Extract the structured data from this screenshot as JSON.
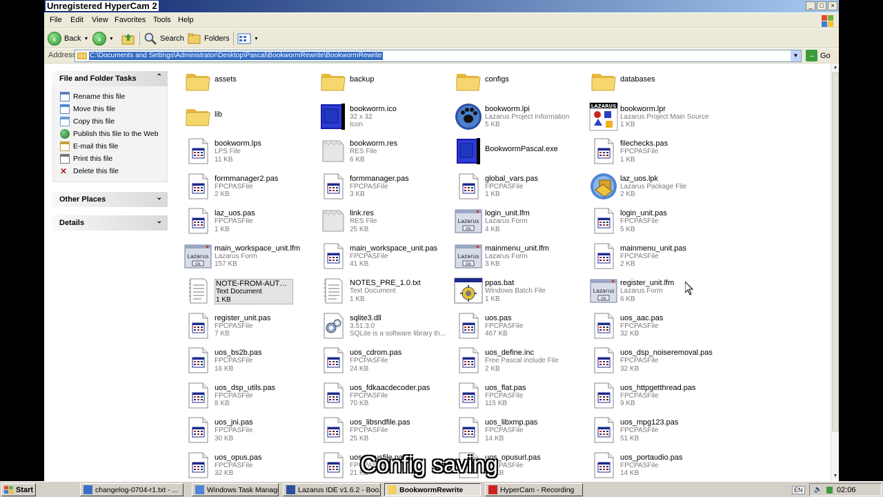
{
  "window": {
    "title": "Unregistered HyperCam 2",
    "controls": [
      "_",
      "□",
      "×"
    ]
  },
  "menu": [
    "File",
    "Edit",
    "View",
    "Favorites",
    "Tools",
    "Help"
  ],
  "toolbar": {
    "back": "Back",
    "search": "Search",
    "folders": "Folders"
  },
  "address": {
    "label": "Address",
    "value": "C:\\Documents and Settings\\Administrator\\Desktop\\Pascal\\BookwormRewrite\\BookwormRewrite",
    "go": "Go"
  },
  "tasks_panel": {
    "title": "File and Folder Tasks",
    "items": [
      {
        "label": "Rename this file",
        "icon": "rename-icon"
      },
      {
        "label": "Move this file",
        "icon": "move-icon"
      },
      {
        "label": "Copy this file",
        "icon": "copy-icon"
      },
      {
        "label": "Publish this file to the Web",
        "icon": "globe-icon"
      },
      {
        "label": "E-mail this file",
        "icon": "email-icon"
      },
      {
        "label": "Print this file",
        "icon": "printer-icon"
      },
      {
        "label": "Delete this file",
        "icon": "delete-icon"
      }
    ]
  },
  "other_places": {
    "title": "Other Places"
  },
  "details": {
    "title": "Details"
  },
  "files": [
    {
      "name": "assets",
      "icon": "folder"
    },
    {
      "name": "backup",
      "icon": "folder"
    },
    {
      "name": "configs",
      "icon": "folder"
    },
    {
      "name": "databases",
      "icon": "folder"
    },
    {
      "name": "lib",
      "icon": "folder"
    },
    {
      "name": "bookworm.ico",
      "type": "32 x 32",
      "size": "Icon",
      "icon": "ico"
    },
    {
      "name": "bookworm.lpi",
      "type": "Lazarus Project Information",
      "size": "5 KB",
      "icon": "lpi"
    },
    {
      "name": "bookworm.lpr",
      "type": "Lazarus Project Main Source",
      "size": "1 KB",
      "icon": "lpr"
    },
    {
      "name": "bookworm.lps",
      "type": "LPS File",
      "size": "11 KB",
      "icon": "pas"
    },
    {
      "name": "bookworm.res",
      "type": "RES File",
      "size": "6 KB",
      "icon": "res"
    },
    {
      "name": "BookwormPascal.exe",
      "icon": "exe"
    },
    {
      "name": "filechecks.pas",
      "type": "FPCPASFile",
      "size": "1 KB",
      "icon": "pas"
    },
    {
      "name": "formmanager2.pas",
      "type": "FPCPASFile",
      "size": "2 KB",
      "icon": "pas"
    },
    {
      "name": "formmanager.pas",
      "type": "FPCPASFile",
      "size": "3 KB",
      "icon": "pas"
    },
    {
      "name": "global_vars.pas",
      "type": "FPCPASFile",
      "size": "1 KB",
      "icon": "pas"
    },
    {
      "name": "laz_uos.lpk",
      "type": "Lazarus Package File",
      "size": "2 KB",
      "icon": "lpk"
    },
    {
      "name": "laz_uos.pas",
      "type": "FPCPASFile",
      "size": "1 KB",
      "icon": "pas"
    },
    {
      "name": "link.res",
      "type": "RES File",
      "size": "25 KB",
      "icon": "res"
    },
    {
      "name": "login_unit.lfm",
      "type": "Lazarus Form",
      "size": "4 KB",
      "icon": "lfm"
    },
    {
      "name": "login_unit.pas",
      "type": "FPCPASFile",
      "size": "5 KB",
      "icon": "pas"
    },
    {
      "name": "main_workspace_unit.lfm",
      "type": "Lazarus Form",
      "size": "157 KB",
      "icon": "lfm"
    },
    {
      "name": "main_workspace_unit.pas",
      "type": "FPCPASFile",
      "size": "41 KB",
      "icon": "pas"
    },
    {
      "name": "mainmenu_unit.lfm",
      "type": "Lazarus Form",
      "size": "3 KB",
      "icon": "lfm"
    },
    {
      "name": "mainmenu_unit.pas",
      "type": "FPCPASFile",
      "size": "2 KB",
      "icon": "pas"
    },
    {
      "name": "NOTE-FROM-AUTHOR.txt",
      "type": "Text Document",
      "size": "1 KB",
      "icon": "txt",
      "selected": true
    },
    {
      "name": "NOTES_PRE_1.0.txt",
      "type": "Text Document",
      "size": "1 KB",
      "icon": "txt"
    },
    {
      "name": "ppas.bat",
      "type": "Windows Batch File",
      "size": "1 KB",
      "icon": "bat"
    },
    {
      "name": "register_unit.lfm",
      "type": "Lazarus Form",
      "size": "6 KB",
      "icon": "lfm"
    },
    {
      "name": "register_unit.pas",
      "type": "FPCPASFile",
      "size": "7 KB",
      "icon": "pas"
    },
    {
      "name": "sqlite3.dll",
      "type": "3.51.3.0",
      "size": "SQLite is a software library th...",
      "icon": "dll"
    },
    {
      "name": "uos.pas",
      "type": "FPCPASFile",
      "size": "467 KB",
      "icon": "pas"
    },
    {
      "name": "uos_aac.pas",
      "type": "FPCPASFile",
      "size": "32 KB",
      "icon": "pas"
    },
    {
      "name": "uos_bs2b.pas",
      "type": "FPCPASFile",
      "size": "16 KB",
      "icon": "pas"
    },
    {
      "name": "uos_cdrom.pas",
      "type": "FPCPASFile",
      "size": "24 KB",
      "icon": "pas"
    },
    {
      "name": "uos_define.inc",
      "type": "Free Pascal include File",
      "size": "2 KB",
      "icon": "pas"
    },
    {
      "name": "uos_dsp_noiseremoval.pas",
      "type": "FPCPASFile",
      "size": "32 KB",
      "icon": "pas"
    },
    {
      "name": "uos_dsp_utils.pas",
      "type": "FPCPASFile",
      "size": "8 KB",
      "icon": "pas"
    },
    {
      "name": "uos_fdkaacdecoder.pas",
      "type": "FPCPASFile",
      "size": "70 KB",
      "icon": "pas"
    },
    {
      "name": "uos_flat.pas",
      "type": "FPCPASFile",
      "size": "115 KB",
      "icon": "pas"
    },
    {
      "name": "uos_httpgetthread.pas",
      "type": "FPCPASFile",
      "size": "9 KB",
      "icon": "pas"
    },
    {
      "name": "uos_jni.pas",
      "type": "FPCPASFile",
      "size": "30 KB",
      "icon": "pas"
    },
    {
      "name": "uos_libsndfile.pas",
      "type": "FPCPASFile",
      "size": "25 KB",
      "icon": "pas"
    },
    {
      "name": "uos_libxmp.pas",
      "type": "FPCPASFile",
      "size": "14 KB",
      "icon": "pas"
    },
    {
      "name": "uos_mpg123.pas",
      "type": "FPCPASFile",
      "size": "51 KB",
      "icon": "pas"
    },
    {
      "name": "uos_opus.pas",
      "type": "FPCPASFile",
      "size": "32 KB",
      "icon": "pas"
    },
    {
      "name": "uos_opusfile.pas",
      "type": "FPCPASFile",
      "size": "21 KB",
      "icon": "pas"
    },
    {
      "name": "uos_opusurl.pas",
      "type": "FPCPASFile",
      "size": "14 KB",
      "icon": "pas"
    },
    {
      "name": "uos_portaudio.pas",
      "type": "FPCPASFile",
      "size": "14 KB",
      "icon": "pas"
    }
  ],
  "overlay_caption": "Config saving",
  "taskbar": {
    "start": "Start",
    "tasks": [
      {
        "label": "changelog-0704-r1.txt - ...",
        "active": false
      },
      {
        "label": "Windows Task Manager",
        "active": false
      },
      {
        "label": "Lazarus IDE v1.6.2 - Boo...",
        "active": false
      },
      {
        "label": "BookwormRewrite",
        "active": true
      },
      {
        "label": "HyperCam - Recording",
        "active": false
      }
    ],
    "lang": "EN",
    "clock": "02:06"
  },
  "colors": {
    "title_start": "#0a246a",
    "title_end": "#a6caf0",
    "selection": "#316ac5",
    "folder": "#f2cf66"
  }
}
